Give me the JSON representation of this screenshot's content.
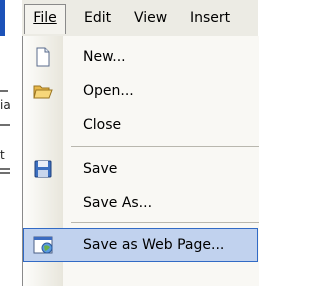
{
  "menubar": {
    "items": [
      {
        "label": "File",
        "active": true
      },
      {
        "label": "Edit"
      },
      {
        "label": "View"
      },
      {
        "label": "Insert"
      }
    ]
  },
  "file_menu": {
    "items": [
      {
        "label": "New...",
        "icon": "new-document-icon"
      },
      {
        "label": "Open...",
        "icon": "open-folder-icon"
      },
      {
        "label": "Close"
      },
      {
        "label": "Save",
        "icon": "save-disk-icon"
      },
      {
        "label": "Save As..."
      },
      {
        "label": "Save as Web Page...",
        "icon": "web-page-icon",
        "highlighted": true
      }
    ]
  },
  "background": {
    "fragments": [
      "ia",
      "t"
    ]
  },
  "colors": {
    "menubar_bg": "#ecebe4",
    "menu_bg": "#f9f8f4",
    "highlight_bg": "#c1d2ee",
    "highlight_border": "#316ac5"
  }
}
